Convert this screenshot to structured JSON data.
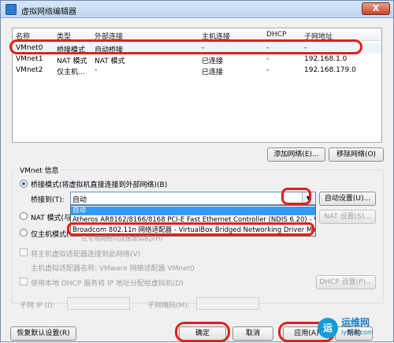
{
  "window": {
    "title": "虚拟网络编辑器",
    "close_label": "X"
  },
  "table": {
    "headers": [
      "名称",
      "类型",
      "外部连接",
      "主机连接",
      "DHCP",
      "子网地址"
    ],
    "rows": [
      [
        "VMnet0",
        "桥接模式",
        "自动桥接",
        "-",
        "-",
        "-"
      ],
      [
        "VMnet1",
        "NAT 模式",
        "NAT 模式",
        "已连接",
        "-",
        "192.168.1.0"
      ],
      [
        "VMnet2",
        "仅主机...",
        "-",
        "已连接",
        "-",
        "192.168.179.0"
      ]
    ]
  },
  "buttons": {
    "add_network": "添加网络(E)...",
    "remove_network": "移除网络(O)",
    "auto_settings": "自动设置(U)...",
    "nat_settings": "NAT 设置(S)...",
    "dhcp_settings": "DHCP 设置(P)...",
    "restore_defaults": "恢复默认设置(R)",
    "ok": "确定",
    "cancel": "取消",
    "apply": "应用(A)",
    "help": "帮助"
  },
  "vmnet_info": {
    "title": "VMnet 信息",
    "bridge_mode": "桥接模式(将虚拟机直接连接到外部网络)(B)",
    "bridge_to_label": "桥接到(T):",
    "bridge_to_value": "自动",
    "nat_mode": "NAT 模式(与",
    "host_only": "仅主机模式(",
    "host_only_suffix": "在专用网络内连接虚拟机)(H)",
    "connect_adapter": "将主机虚拟适配器连接到此网络(V)",
    "adapter_name": "主机虚拟适配器名称: VMware 网络适配器 VMnet0",
    "use_dhcp": "使用本地 DHCP 服务将 IP 地址分配给虚拟机(D)",
    "subnet_ip_label": "子网 IP (I):",
    "subnet_mask_label": "子网掩码(M):"
  },
  "dropdown": {
    "options": [
      "自动",
      "Atheros AR8162/8166/8168 PCI-E Fast Ethernet Controller (NDIS 6.20) - Vir",
      "Broadcom 802.11n 网络适配器 - VirtualBox Bridged Networking Driver Minip"
    ]
  },
  "watermark": {
    "logo": "运",
    "text": "运维网",
    "sub": "iyunv.com"
  },
  "colors": {
    "highlight": "#e0201d",
    "selection": "#3399ff"
  }
}
